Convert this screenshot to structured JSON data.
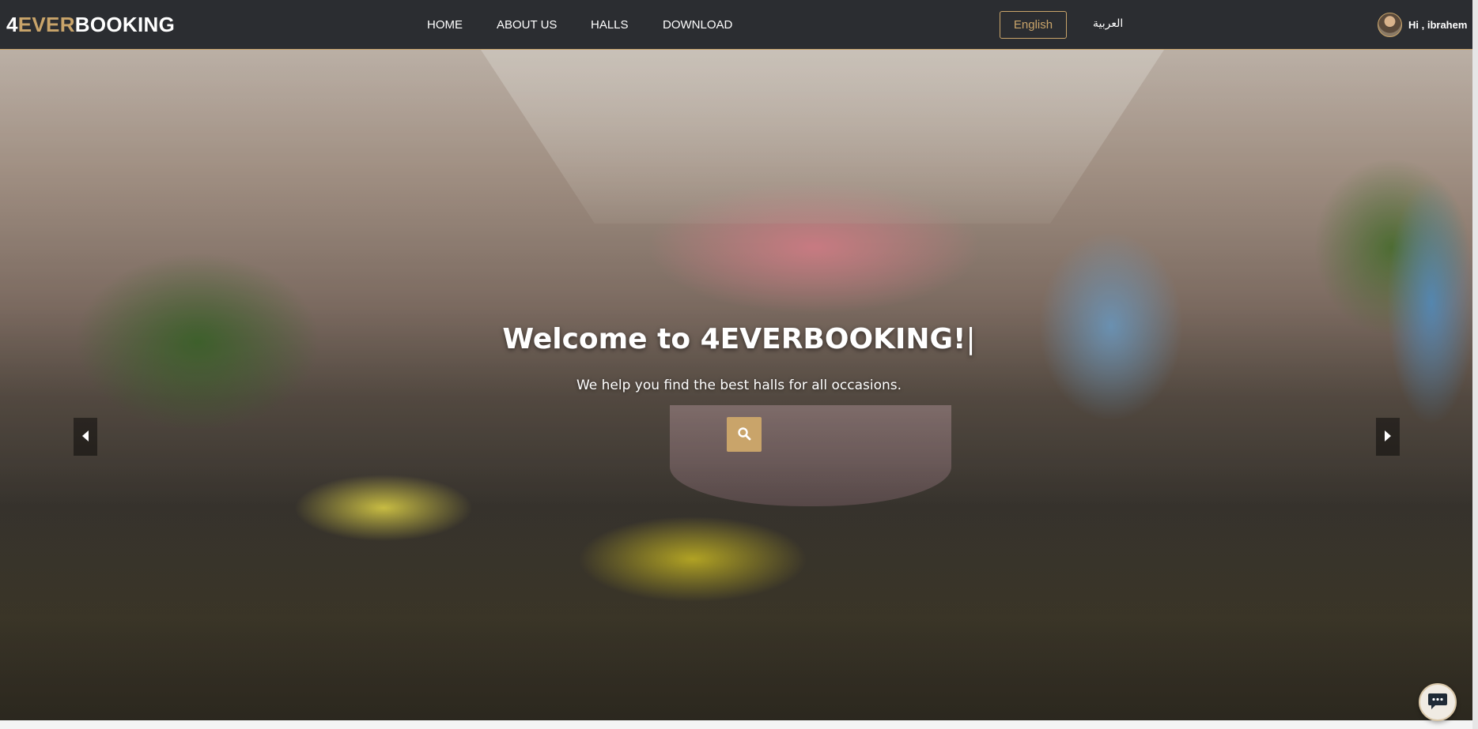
{
  "brand": {
    "part1": "4",
    "part2": "EVER",
    "part3": "BOOKING"
  },
  "nav": {
    "links": [
      {
        "label": "HOME"
      },
      {
        "label": "ABOUT US"
      },
      {
        "label": "HALLS"
      },
      {
        "label": "DOWNLOAD"
      }
    ],
    "language_active": "English",
    "language_alt": "العربية",
    "greeting": "Hi , ibrahem"
  },
  "hero": {
    "title": "Welcome to 4EVERBOOKING!",
    "cursor": "|",
    "tagline": "We help you find the best halls for all occasions."
  },
  "icons": {
    "search": "search-icon",
    "prev": "chevron-left-icon",
    "next": "chevron-right-icon",
    "chat": "chat-icon"
  },
  "colors": {
    "navbar": "#2b2d31",
    "accent": "#c9a46a",
    "text": "#ffffff"
  }
}
